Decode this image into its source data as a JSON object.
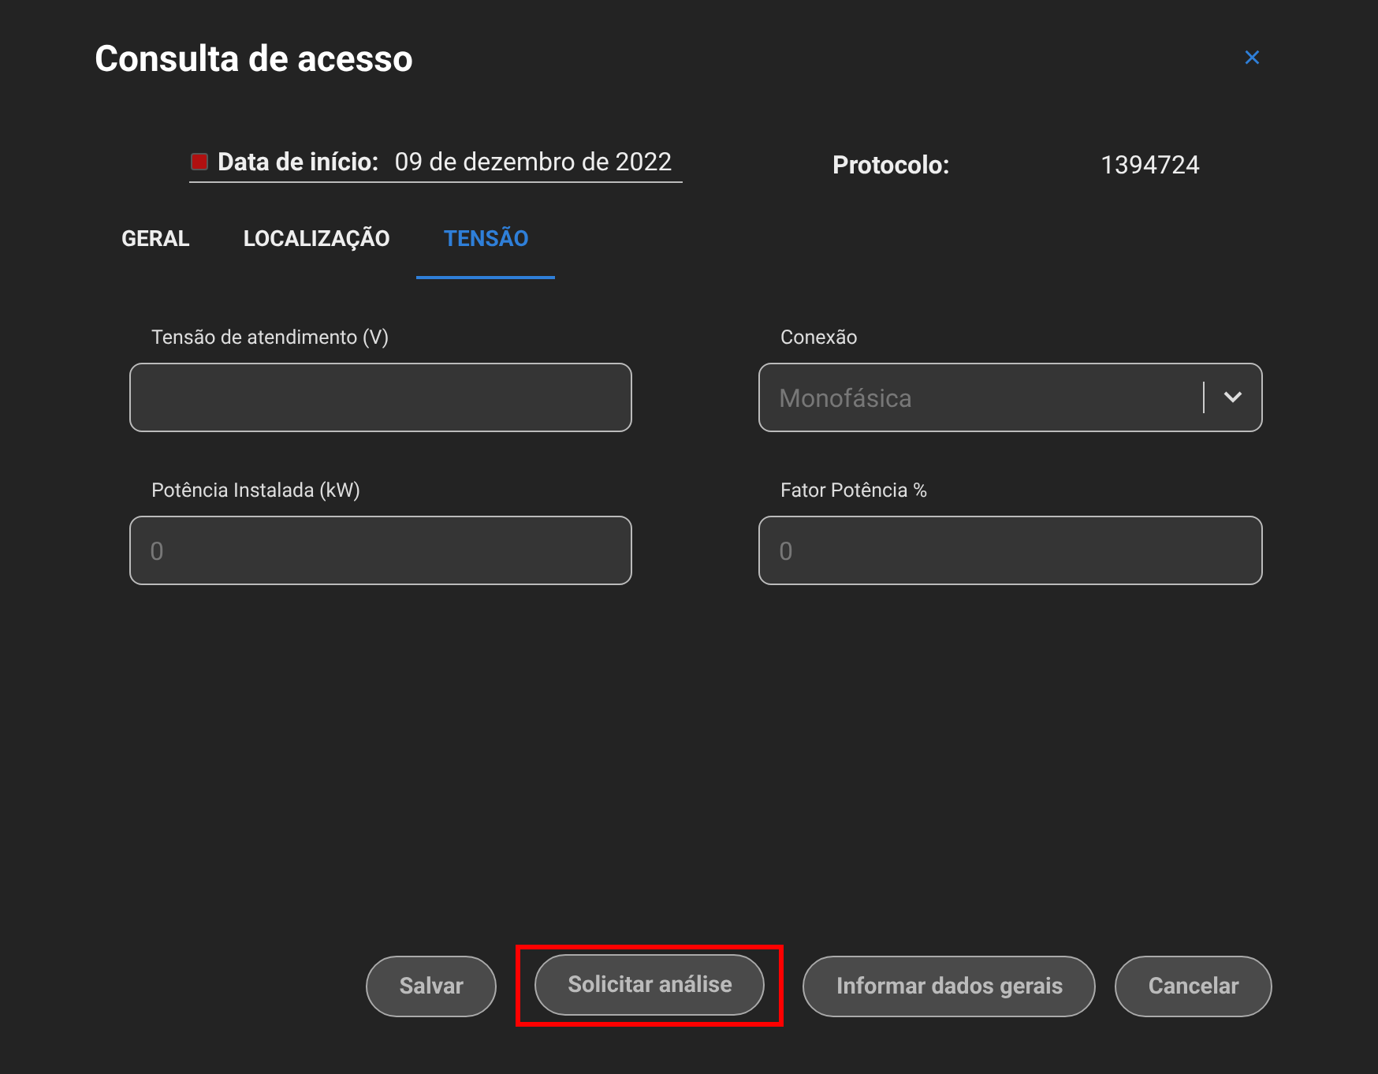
{
  "window": {
    "title": "Consulta de acesso",
    "close": "×"
  },
  "info": {
    "start_label": "Data de início:",
    "start_value": "09 de dezembro de 2022",
    "protocol_label": "Protocolo:",
    "protocol_value": "1394724"
  },
  "tabs": [
    {
      "label": "GERAL",
      "selected": false
    },
    {
      "label": "LOCALIZAÇÃO",
      "selected": false
    },
    {
      "label": "TENSÃO",
      "selected": true
    }
  ],
  "fields": [
    {
      "kind": "text",
      "label": "Tensão de atendimento (V)"
    },
    {
      "kind": "select",
      "label": "Conexão",
      "placeholder": "Monofásica"
    },
    {
      "kind": "text",
      "label": "Potência Instalada (kW)",
      "placeholder": "0"
    },
    {
      "kind": "text",
      "label": "Fator Potência %",
      "placeholder": "0"
    }
  ],
  "buttons": [
    {
      "label": "Salvar",
      "highlighted": false
    },
    {
      "label": "Solicitar análise",
      "highlighted": true
    },
    {
      "label": "Informar dados gerais",
      "highlighted": false
    },
    {
      "label": "Cancelar",
      "highlighted": false
    }
  ]
}
